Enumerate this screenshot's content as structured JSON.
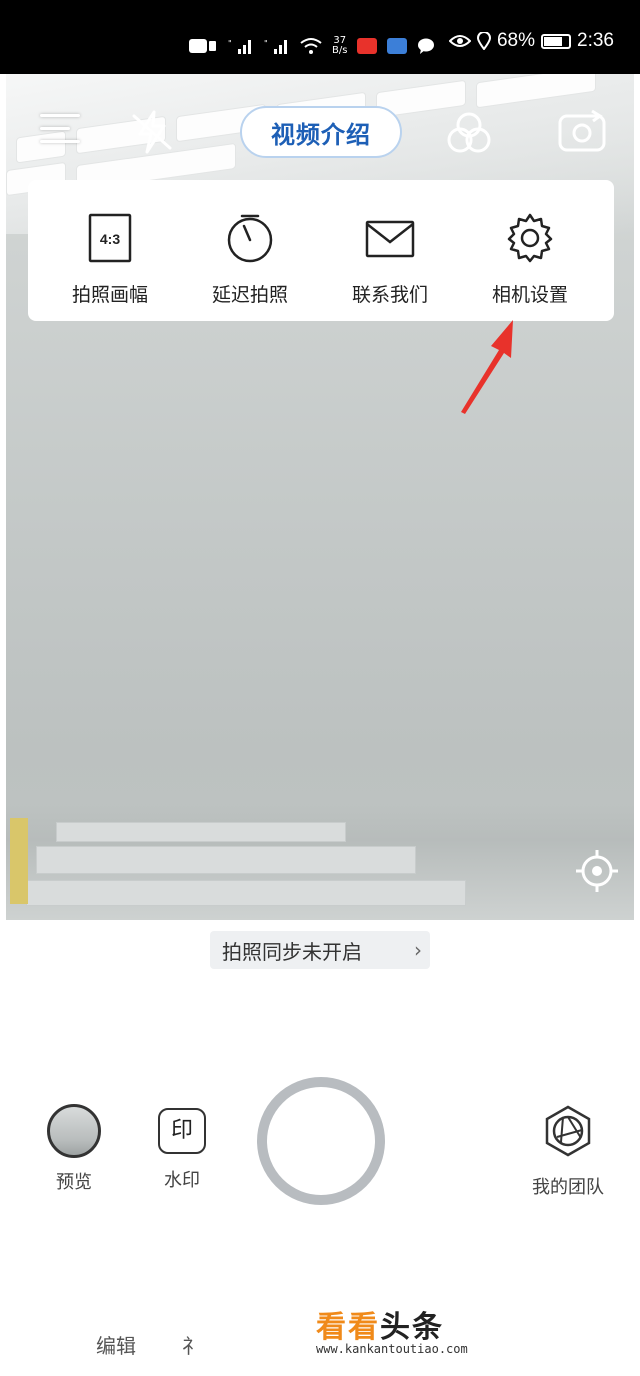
{
  "status_bar": {
    "network_speed": "37",
    "network_unit": "B/s",
    "battery": "68%",
    "time": "2:36"
  },
  "top_bar": {
    "intro_label": "视频介绍"
  },
  "panel": {
    "items": [
      {
        "label": "拍照画幅",
        "icon_text": "4:3"
      },
      {
        "label": "延迟拍照"
      },
      {
        "label": "联系我们"
      },
      {
        "label": "相机设置"
      }
    ]
  },
  "sync": {
    "label": "拍照同步未开启",
    "chevron": "›"
  },
  "tools": {
    "preview_label": "预览",
    "watermark_label": "水印",
    "watermark_icon_text": "印",
    "team_label": "我的团队"
  },
  "bottom_tabs": {
    "edit_label": "编辑",
    "partial_label": "礻"
  },
  "watermark_logo": {
    "cn_part1": "看看",
    "cn_part2": "头条",
    "url": "www.kankantoutiao.com"
  },
  "colors": {
    "accent_blue": "#1d5fb6",
    "arrow_red": "#e8322b",
    "logo_orange": "#f08a1a"
  }
}
